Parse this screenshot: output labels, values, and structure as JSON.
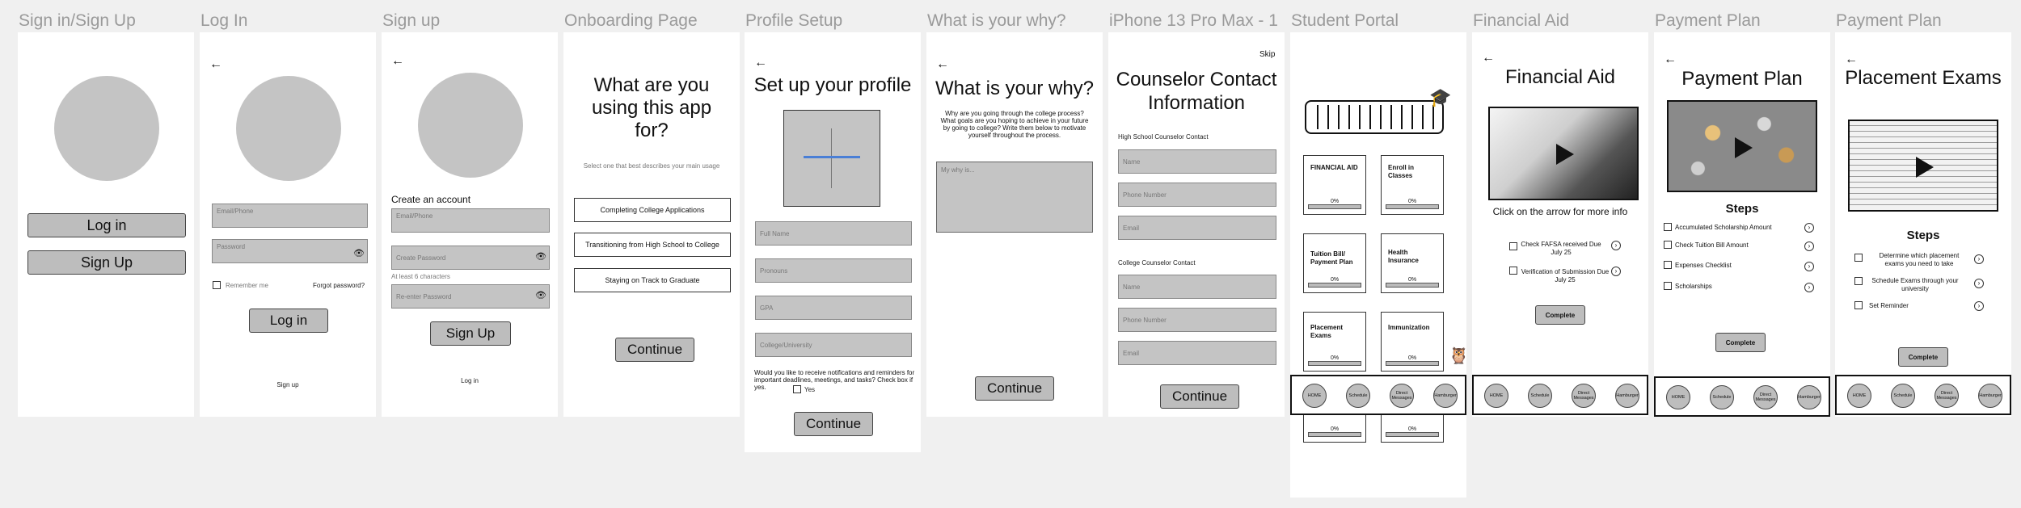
{
  "frames": {
    "signin_signup": {
      "title": "Sign in/Sign Up",
      "login": "Log in",
      "signup": "Sign Up"
    },
    "login": {
      "title": "Log In",
      "email_placeholder": "Email/Phone",
      "password_placeholder": "Password",
      "remember": "Remember me",
      "forgot": "Forgot password?",
      "login_button": "Log in",
      "signup_link": "Sign up"
    },
    "signup": {
      "title": "Sign up",
      "create_account": "Create an account",
      "email_placeholder": "Email/Phone",
      "password_placeholder": "Create Password",
      "hint": "At least 6 characters",
      "reenter_placeholder": "Re-enter Password",
      "signup_button": "Sign Up",
      "login_link": "Log in"
    },
    "onboarding": {
      "title": "Onboarding Page",
      "heading": "What are you using this app for?",
      "subtitle": "Select one that best describes your main usage",
      "options": [
        "Completing College Applications",
        "Transitioning from High School to College",
        "Staying on Track to Graduate"
      ],
      "continue": "Continue"
    },
    "profile": {
      "title": "Profile Setup",
      "heading": "Set up your profile",
      "fields": [
        "Full Name",
        "Pronouns",
        "GPA",
        "College/University"
      ],
      "notify": "Would you like to receive notifications and reminders for important deadlines, meetings, and tasks? Check box if yes.",
      "yes": "Yes",
      "continue": "Continue"
    },
    "why": {
      "title": "What is your why?",
      "heading": "What is your why?",
      "prompt": "Why are you going through the college process? What goals are you hoping to achieve in your future by going to college? Write them below to motivate yourself throughout the process.",
      "placeholder": "My why is...",
      "continue": "Continue"
    },
    "counselor": {
      "title": "iPhone 13 Pro Max - 1",
      "skip": "Skip",
      "heading": "Counselor Contact Information",
      "hs_label": "High School Counselor Contact",
      "college_label": "College Counselor Contact",
      "fields": [
        "Name",
        "Phone Number",
        "Email"
      ],
      "continue": "Continue"
    },
    "portal": {
      "title": "Student Portal",
      "tiles": [
        {
          "label": "FINANCIAL AID",
          "pct": "0%"
        },
        {
          "label": "Enroll in Classes",
          "pct": "0%"
        },
        {
          "label": "Tuition Bill/ Payment Plan",
          "pct": "0%"
        },
        {
          "label": "Health Insurance",
          "pct": "0%"
        },
        {
          "label": "Placement Exams",
          "pct": "0%"
        },
        {
          "label": "Immunization",
          "pct": "0%"
        },
        {
          "label": "",
          "pct": "0%"
        },
        {
          "label": "",
          "pct": "0%"
        }
      ]
    },
    "finaid": {
      "title": "Financial Aid",
      "heading": "Financial Aid",
      "caption": "Click on the arrow for more info",
      "items": [
        "Check FAFSA received Due July 25",
        "Verification of Submission Due July 25"
      ],
      "complete": "Complete"
    },
    "payment": {
      "title": "Payment Plan",
      "heading": "Payment Plan",
      "steps_heading": "Steps",
      "items": [
        "Accumulated Scholarship Amount",
        "Check Tuition Bill Amount",
        "Expenses Checklist",
        "Scholarships"
      ],
      "complete": "Complete"
    },
    "placement": {
      "title": "Payment Plan",
      "heading": "Placement Exams",
      "steps_heading": "Steps",
      "items": [
        "Determine which placement exams you need to take",
        "Schedule Exams through your university",
        "Set Reminder"
      ],
      "complete": "Complete"
    }
  },
  "nav": [
    "HOME",
    "Schedule",
    "Direct Messages",
    "Hamburger"
  ],
  "icons": {
    "back": "back-arrow-icon",
    "arrow": "arrow-right-circle-icon",
    "play": "play-icon",
    "eye": "eye-icon",
    "grad_cap": "graduation-cap-icon"
  }
}
